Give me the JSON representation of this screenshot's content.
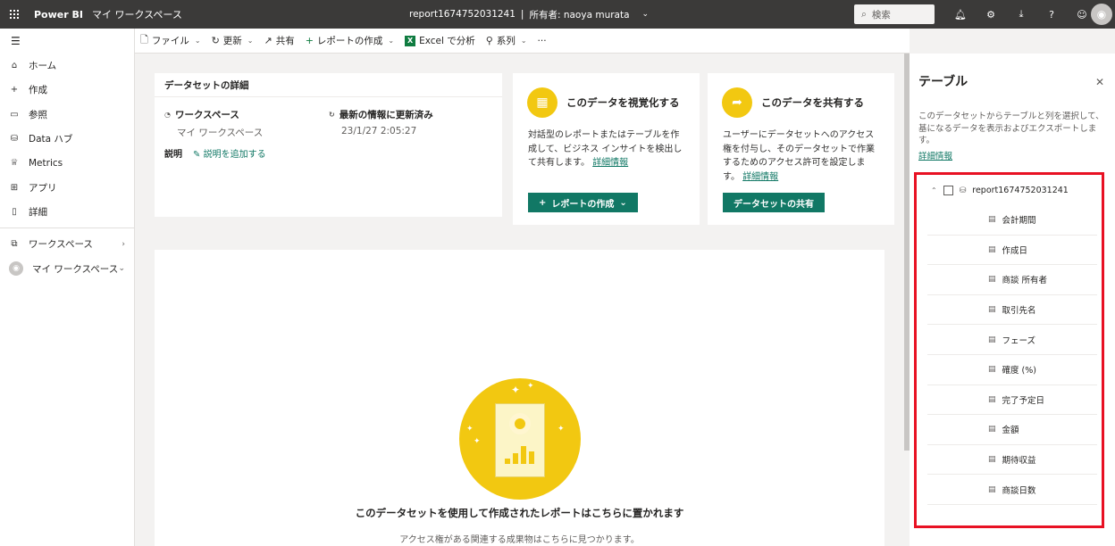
{
  "topbar": {
    "brand": "Power BI",
    "workspace": "マイ ワークスペース",
    "report_name": "report1674752031241",
    "separator": "|",
    "owner": "所有者: naoya murata",
    "search_placeholder": "検索"
  },
  "nav": {
    "items": [
      {
        "label": "ホーム",
        "icon": "home-icon"
      },
      {
        "label": "作成",
        "icon": "plus-icon"
      },
      {
        "label": "参照",
        "icon": "folder-icon"
      },
      {
        "label": "Data ハブ",
        "icon": "database-icon"
      },
      {
        "label": "Metrics",
        "icon": "trophy-icon"
      },
      {
        "label": "アプリ",
        "icon": "apps-icon"
      },
      {
        "label": "詳細",
        "icon": "book-icon"
      }
    ],
    "workspaces": "ワークスペース",
    "my_workspace": "マイ ワークスペース"
  },
  "commands": {
    "file": "ファイル",
    "refresh": "更新",
    "share": "共有",
    "create_report": "レポートの作成",
    "excel_analyze": "Excel で分析",
    "lineage": "系列",
    "more": "···"
  },
  "details": {
    "title": "データセットの詳細",
    "workspace_label": "ワークスペース",
    "workspace_value": "マイ ワークスペース",
    "refresh_label": "最新の情報に更新済み",
    "refresh_value": "23/1/27 2:05:27",
    "description_label": "説明",
    "add_description": "説明を追加する"
  },
  "visualize": {
    "title": "このデータを視覚化する",
    "text": "対話型のレポートまたはテーブルを作成して、ビジネス インサイトを検出して共有します。",
    "link": "詳細情報",
    "button": "レポートの作成"
  },
  "share": {
    "title": "このデータを共有する",
    "text": "ユーザーにデータセットへのアクセス権を付与し、そのデータセットで作業するためのアクセス許可を設定します。",
    "link": "詳細情報",
    "button": "データセットの共有"
  },
  "reports": {
    "title": "このデータセットを使用して作成されたレポートはこちらに置かれます",
    "subtitle": "アクセス権がある関連する成果物はこちらに見つかります。"
  },
  "panel": {
    "title": "テーブル",
    "description": "このデータセットからテーブルと列を選択して、基になるデータを表示およびエクスポートします。",
    "link": "詳細情報",
    "table_name": "report1674752031241",
    "fields": [
      "会計期間",
      "作成日",
      "商談 所有者",
      "取引先名",
      "フェーズ",
      "確度 (%)",
      "完了予定日",
      "金額",
      "期待収益",
      "商談日数"
    ]
  }
}
